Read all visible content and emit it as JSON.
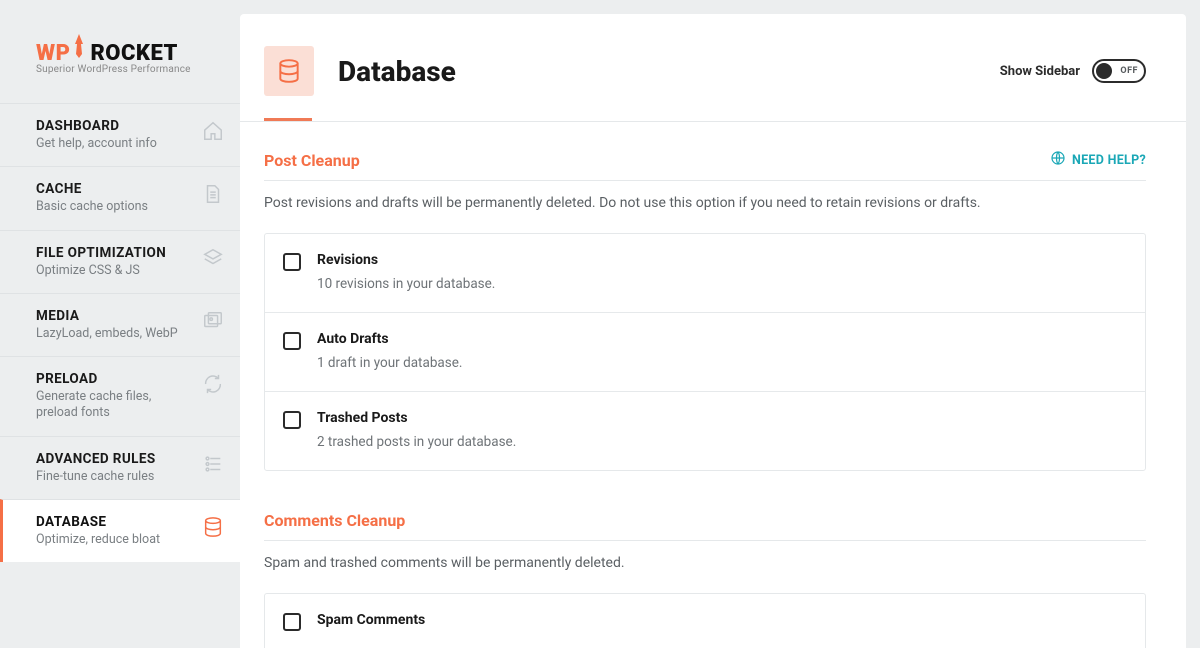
{
  "brand": {
    "wp": "WP",
    "rocket": "ROCKET",
    "tagline": "Superior WordPress Performance"
  },
  "sidebar": {
    "items": [
      {
        "title": "DASHBOARD",
        "sub": "Get help, account info",
        "icon": "home-icon"
      },
      {
        "title": "CACHE",
        "sub": "Basic cache options",
        "icon": "file-icon"
      },
      {
        "title": "FILE OPTIMIZATION",
        "sub": "Optimize CSS & JS",
        "icon": "layers-icon"
      },
      {
        "title": "MEDIA",
        "sub": "LazyLoad, embeds, WebP",
        "icon": "images-icon"
      },
      {
        "title": "PRELOAD",
        "sub": "Generate cache files, preload fonts",
        "icon": "refresh-icon"
      },
      {
        "title": "ADVANCED RULES",
        "sub": "Fine-tune cache rules",
        "icon": "sliders-icon"
      },
      {
        "title": "DATABASE",
        "sub": "Optimize, reduce bloat",
        "icon": "database-icon"
      }
    ]
  },
  "header": {
    "title": "Database",
    "show_sidebar_label": "Show Sidebar",
    "toggle_state": "OFF"
  },
  "need_help": "NEED HELP?",
  "sections": {
    "post_cleanup": {
      "title": "Post Cleanup",
      "desc": "Post revisions and drafts will be permanently deleted. Do not use this option if you need to retain revisions or drafts.",
      "options": [
        {
          "title": "Revisions",
          "sub": "10 revisions in your database."
        },
        {
          "title": "Auto Drafts",
          "sub": "1 draft in your database."
        },
        {
          "title": "Trashed Posts",
          "sub": "2 trashed posts in your database."
        }
      ]
    },
    "comments_cleanup": {
      "title": "Comments Cleanup",
      "desc": "Spam and trashed comments will be permanently deleted.",
      "options": [
        {
          "title": "Spam Comments",
          "sub": ""
        }
      ]
    }
  }
}
